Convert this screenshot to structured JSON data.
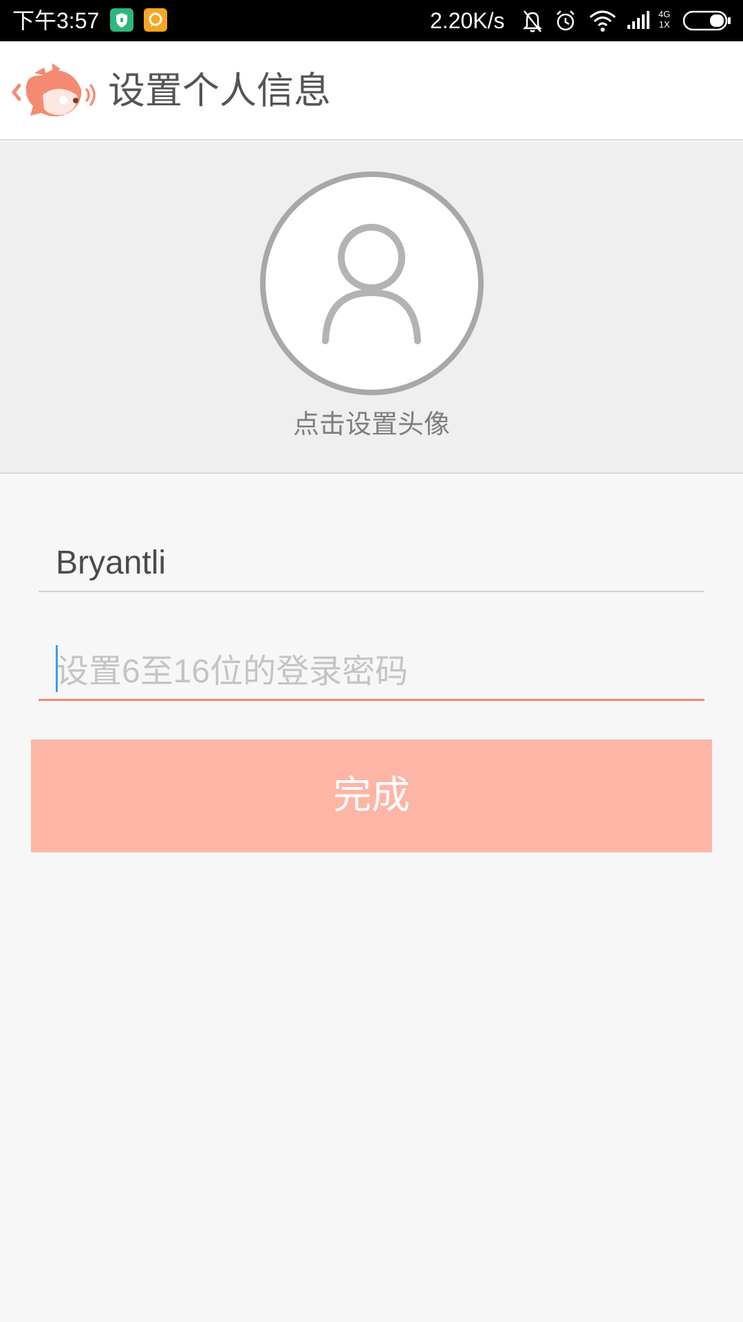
{
  "status_bar": {
    "time": "下午3:57",
    "network_speed": "2.20K/s",
    "network_type_top": "4G",
    "network_type_bottom": "1X",
    "icons": [
      "shield-app-icon",
      "chat-app-icon",
      "mute-bell-icon",
      "alarm-icon",
      "wifi-icon",
      "signal-icon",
      "battery-icon"
    ]
  },
  "app_bar": {
    "title": "设置个人信息",
    "back_icon": "fish-mascot-back-icon"
  },
  "avatar": {
    "icon": "user-placeholder-icon",
    "hint": "点击设置头像"
  },
  "form": {
    "username_value": "Bryantli",
    "password_placeholder": "设置6至16位的登录密码",
    "password_value": "",
    "submit_label": "完成"
  },
  "colors": {
    "accent": "#f58a72",
    "button_bg": "#fdb5a5",
    "cursor": "#3f9ce8"
  }
}
